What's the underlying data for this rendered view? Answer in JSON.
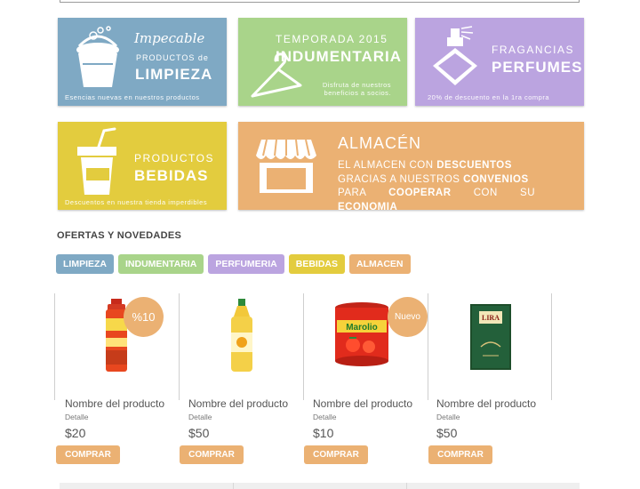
{
  "banners": {
    "limpieza": {
      "script": "Impecable",
      "line1": "PRODUCTOS de",
      "line2": "LIMPIEZA",
      "caption": "Esencias nuevas en nuestros productos",
      "icon": "bucket-icon",
      "color": "#7fa9c4"
    },
    "indumentaria": {
      "line1": "TEMPORADA 2015",
      "line2": "INDUMENTARIA",
      "caption1": "Disfruta de nuestros",
      "caption2": "beneficios a socios.",
      "icon": "hanger-icon",
      "color": "#a9d48a"
    },
    "perfumes": {
      "line1": "FRAGANCIAS",
      "line2": "PERFUMES",
      "caption": "20% de descuento en la 1ra compra",
      "icon": "perfume-bottle-icon",
      "color": "#bba4e0"
    },
    "bebidas": {
      "line1": "PRODUCTOS",
      "line2": "BEBIDAS",
      "caption": "Descuentos en nuestra tienda imperdibles",
      "icon": "drink-cup-icon",
      "color": "#e3cc3e"
    },
    "almacen": {
      "title": "ALMACÉN",
      "text": [
        {
          "a": "EL  ALMACEN  CON ",
          "b": "DESCUENTOS"
        },
        {
          "a": "GRACIAS  A  NUESTROS ",
          "b": "CONVENIOS"
        },
        {
          "a": "PARA ",
          "b": "COOPERAR",
          "c": " CON SU ",
          "d": "ECONOMIA"
        }
      ],
      "icon": "store-icon",
      "color": "#ebb173"
    }
  },
  "section_title": "OFERTAS Y NOVEDADES",
  "filters": [
    {
      "label": "LIMPIEZA",
      "color": "#7fa9c4"
    },
    {
      "label": "INDUMENTARIA",
      "color": "#a9d48a"
    },
    {
      "label": "PERFUMERIA",
      "color": "#bba4e0"
    },
    {
      "label": "BEBIDAS",
      "color": "#e3cc3e"
    },
    {
      "label": "ALMACEN",
      "color": "#ebb173"
    }
  ],
  "products": [
    {
      "name": "Nombre del producto",
      "detail": "Detalle",
      "price": "$20",
      "buy": "COMPRAR",
      "badge": "%10",
      "image": "spray-can-icon"
    },
    {
      "name": "Nombre del producto",
      "detail": "Detalle",
      "price": "$50",
      "buy": "COMPRAR",
      "badge": "",
      "image": "oil-bottle-icon"
    },
    {
      "name": "Nombre del producto",
      "detail": "Detalle",
      "price": "$10",
      "buy": "COMPRAR",
      "badge": "Nuevo",
      "image": "tomato-can-icon"
    },
    {
      "name": "Nombre del producto",
      "detail": "Detalle",
      "price": "$50",
      "buy": "COMPRAR",
      "badge": "",
      "image": "olive-oil-tin-icon"
    }
  ],
  "product_labels": {
    "naranja": "Marolio",
    "lira": "LIRA"
  }
}
